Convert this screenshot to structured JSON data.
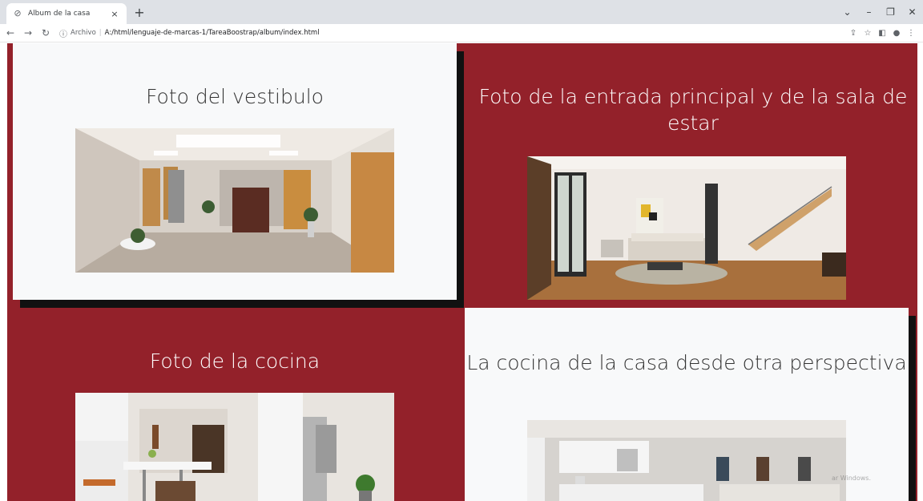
{
  "browser": {
    "tab_title": "Album de la casa",
    "tab_close": "×",
    "new_tab": "+",
    "url_prefix": "Archivo",
    "url": "A:/html/lenguaje-de-marcas-1/TareaBoostrap/album/index.html"
  },
  "cards": [
    {
      "title": "Foto del vestibulo"
    },
    {
      "title": "Foto de la entrada principal y de la sala de estar"
    },
    {
      "title": "Foto de la cocina"
    },
    {
      "title": "La cocina de la casa desde otra perspectiva"
    }
  ],
  "watermark": "ar Windows.",
  "colors": {
    "page_background": "#93212a",
    "light_card": "#f8f9fa",
    "shadow": "#111111"
  }
}
